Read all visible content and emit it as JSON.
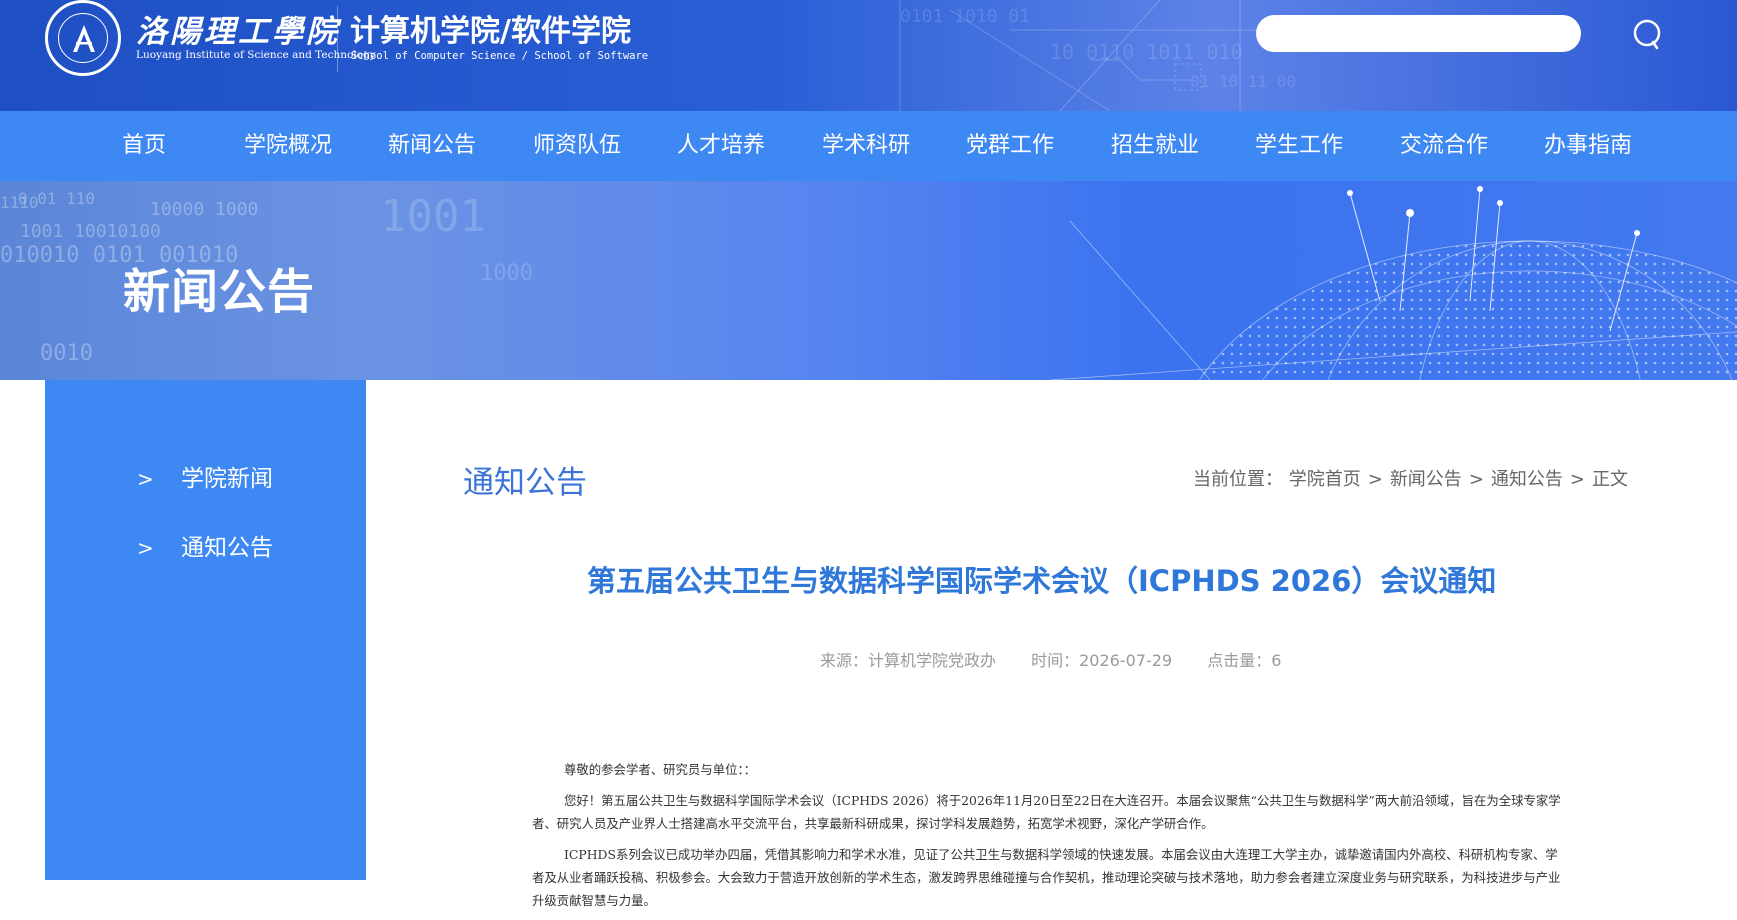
{
  "header": {
    "school_name_cn": "洛陽理工學院",
    "school_name_en": "Luoyang Institute of Science and Technology",
    "college_name_cn": "计算机学院/软件学院",
    "college_name_en": "School of Computer Science / School of Software",
    "search": {
      "value": "",
      "placeholder": ""
    }
  },
  "nav": {
    "items": [
      {
        "label": "首页"
      },
      {
        "label": "学院概况"
      },
      {
        "label": "新闻公告"
      },
      {
        "label": "师资队伍"
      },
      {
        "label": "人才培养"
      },
      {
        "label": "学术科研"
      },
      {
        "label": "党群工作"
      },
      {
        "label": "招生就业"
      },
      {
        "label": "学生工作"
      },
      {
        "label": "交流合作"
      },
      {
        "label": "办事指南"
      }
    ]
  },
  "banner": {
    "title": "新闻公告"
  },
  "sidebar": {
    "items": [
      {
        "label": "学院新闻"
      },
      {
        "label": "通知公告"
      }
    ]
  },
  "content": {
    "section_title": "通知公告",
    "breadcrumb": {
      "prefix": "当前位置：",
      "items": [
        "学院首页",
        "新闻公告",
        "通知公告",
        "正文"
      ]
    },
    "article": {
      "title": "第五届公共卫生与数据科学国际学术会议（ICPHDS 2026）会议通知",
      "source": "来源：计算机学院党政办",
      "time": "时间：2026-07-29",
      "views": "点击量：6",
      "salutation": "尊敬的参会学者、研究员与单位：：",
      "paragraphs": [
        "您好！第五届公共卫生与数据科学国际学术会议（ICPHDS 2026）将于2026年11月20日至22日在大连召开。本届会议聚焦“公共卫生与数据科学”两大前沿领域，旨在为全球专家学者、研究人员及产业界人士搭建高水平交流平台，共享最新科研成果，探讨学科发展趋势，拓宽学术视野，深化产学研合作。",
        "ICPHDS系列会议已成功举办四届，凭借其影响力和学术水准，见证了公共卫生与数据科学领域的快速发展。本届会议由大连理工大学主办，诚挚邀请国内外高校、科研机构专家、学者及从业者踊跃投稿、积极参会。大会致力于营造开放创新的学术生态，激发跨界思维碰撞与合作契机，推动理论突破与技术落地，助力参会者建立深度业务与研究联系，为科技进步与产业升级贡献智慧与力量。"
      ]
    }
  },
  "colors": {
    "header_blue": "#2a5fd6",
    "nav_blue": "#3e88f4",
    "sidebar_blue": "#3e88f4",
    "title_blue": "#2f78d9",
    "section_title_blue": "#3b73d8"
  }
}
